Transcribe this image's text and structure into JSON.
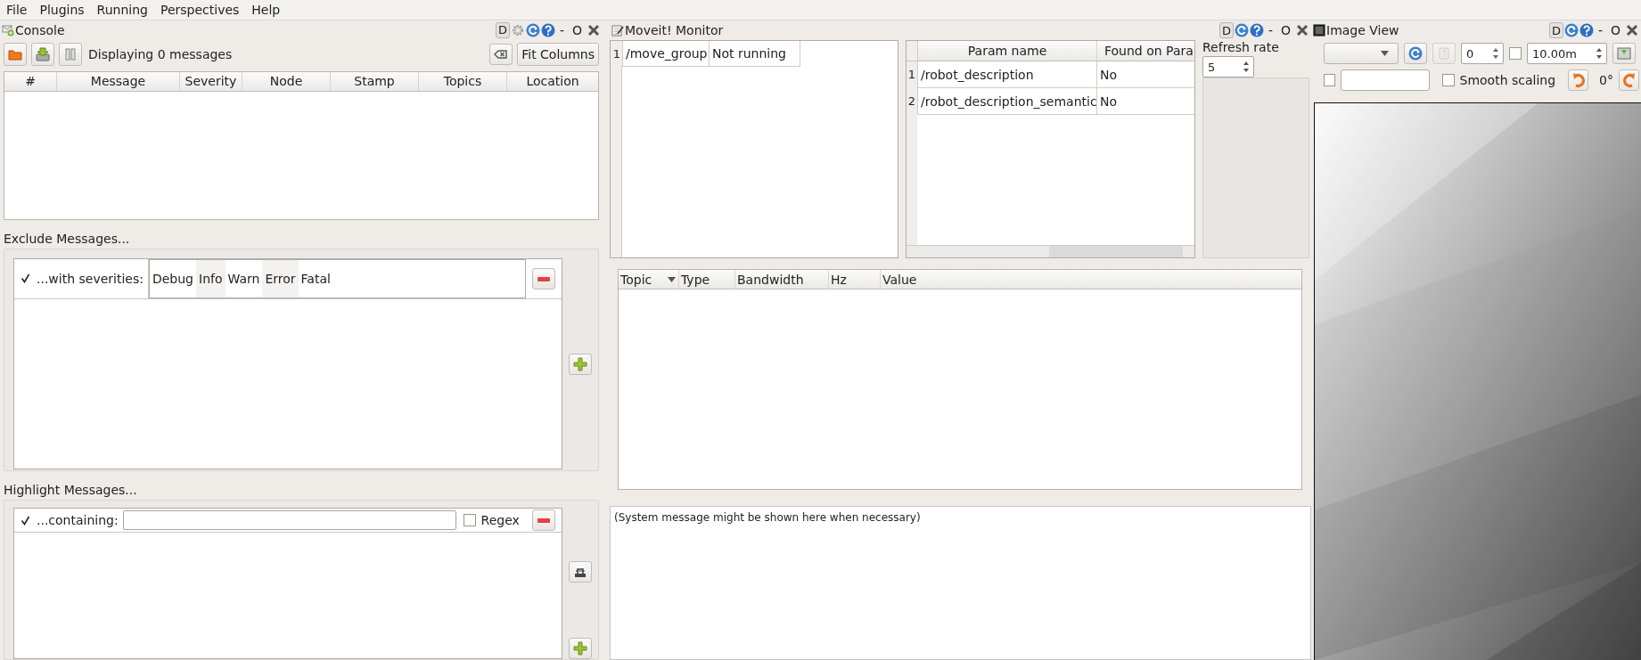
{
  "menu": [
    "File",
    "Plugins",
    "Running",
    "Perspectives",
    "Help"
  ],
  "console": {
    "title": "Console",
    "controls": {
      "dock": "D",
      "minimize": "-",
      "float": "O",
      "settings": true
    },
    "status": "Displaying 0 messages",
    "fit_button": "Fit Columns",
    "columns": [
      "#",
      "Message",
      "Severity",
      "Node",
      "Stamp",
      "Topics",
      "Location"
    ],
    "exclude": {
      "title": "Exclude Messages...",
      "filters": [
        {
          "checked": true,
          "label": "...with severities:",
          "severities": [
            "Debug",
            "Info",
            "Warn",
            "Error",
            "Fatal"
          ]
        }
      ]
    },
    "highlight": {
      "title": "Highlight Messages...",
      "filters": [
        {
          "checked": true,
          "label": "...containing:",
          "regex": {
            "label": "Regex",
            "checked": false
          }
        }
      ]
    }
  },
  "moveit": {
    "title": "Moveit! Monitor",
    "controls": {
      "dock": "D",
      "minimize": "-",
      "float": "O",
      "settings": false
    },
    "nodes": [
      {
        "index": "1",
        "name": "/move_group",
        "status": "Not running"
      }
    ],
    "params": {
      "columns": [
        "Param name",
        "Found on Para"
      ],
      "rows": [
        {
          "index": "1",
          "name": "/robot_description",
          "found": "No"
        },
        {
          "index": "2",
          "name": "/robot_description_semantic",
          "found": "No"
        }
      ]
    },
    "refresh": {
      "label": "Refresh rate",
      "value": "5"
    }
  },
  "topics": {
    "columns": [
      {
        "label": "Topic",
        "sorted": true
      },
      {
        "label": "Type",
        "sorted": false
      },
      {
        "label": "Bandwidth",
        "sorted": false
      },
      {
        "label": "Hz",
        "sorted": false
      },
      {
        "label": "Value",
        "sorted": false
      }
    ]
  },
  "system_message": "(System message might be shown here when necessary)",
  "image_view": {
    "title": "Image View",
    "controls": {
      "dock": "D",
      "minimize": "-",
      "float": "O",
      "settings": false
    },
    "spin_value": "0",
    "limit_checked": false,
    "limit_value": "10.00m",
    "mouse_checked": false,
    "smooth_scaling": {
      "label": "Smooth scaling",
      "checked": false
    },
    "rotation": "0°"
  }
}
